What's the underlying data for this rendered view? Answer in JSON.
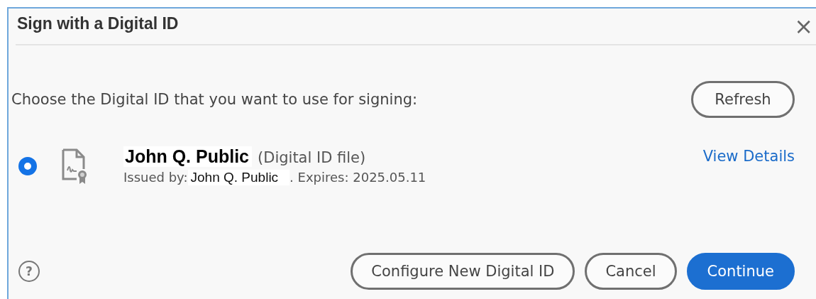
{
  "dialog": {
    "title": "Sign with a Digital ID",
    "close": "×"
  },
  "prompt": "Choose the Digital ID that you want to use for signing:",
  "refresh_button": "Refresh",
  "ids": [
    {
      "name": "John Q. Public",
      "type": "(Digital ID file)",
      "issued_by_label": "Issued by:",
      "issuer": "John Q. Public",
      "expires": ". Expires: 2025.05.11",
      "selected": true,
      "link": "View Details"
    }
  ],
  "help": "?",
  "buttons": [
    {
      "label": "Configure New Digital ID",
      "kind": "outline"
    },
    {
      "label": "Cancel",
      "kind": "outline"
    },
    {
      "label": "Continue",
      "kind": "primary"
    }
  ]
}
